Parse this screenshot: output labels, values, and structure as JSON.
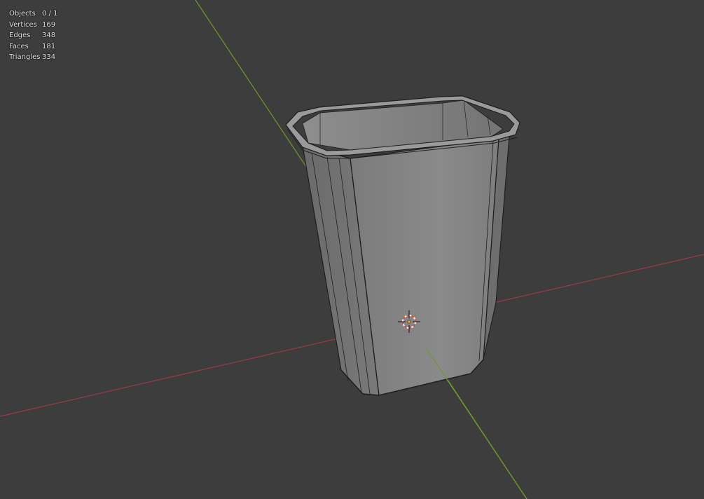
{
  "stats": {
    "rows": [
      {
        "label": "Objects",
        "value": "0 / 1"
      },
      {
        "label": "Vertices",
        "value": "169"
      },
      {
        "label": "Edges",
        "value": "348"
      },
      {
        "label": "Faces",
        "value": "181"
      },
      {
        "label": "Triangles",
        "value": "334"
      }
    ]
  },
  "colors": {
    "background": "#3d3d3d",
    "x_axis": "#9b3a45",
    "y_axis": "#6f9a2a",
    "mesh_face": "#8a8a8a",
    "mesh_edge": "#1e1e1e"
  },
  "icons": {
    "cursor": "3d-cursor-icon",
    "origin": "object-origin-icon"
  }
}
